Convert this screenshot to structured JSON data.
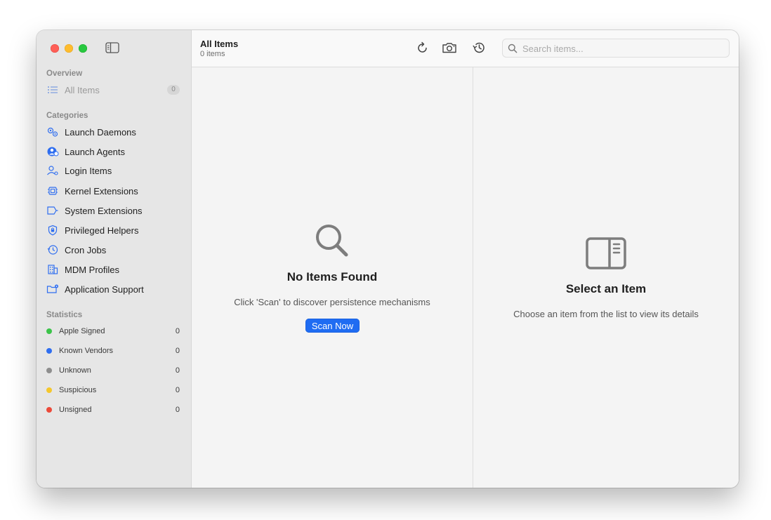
{
  "sidebar": {
    "overview_title": "Overview",
    "all_items": {
      "label": "All Items",
      "count": "0"
    },
    "categories_title": "Categories",
    "categories": [
      {
        "label": "Launch Daemons",
        "icon": "gears-icon"
      },
      {
        "label": "Launch Agents",
        "icon": "person-circle-icon"
      },
      {
        "label": "Login Items",
        "icon": "person-gear-icon"
      },
      {
        "label": "Kernel Extensions",
        "icon": "cpu-icon"
      },
      {
        "label": "System Extensions",
        "icon": "puzzle-icon"
      },
      {
        "label": "Privileged Helpers",
        "icon": "shield-icon"
      },
      {
        "label": "Cron Jobs",
        "icon": "clock-icon"
      },
      {
        "label": "MDM Profiles",
        "icon": "building-icon"
      },
      {
        "label": "Application Support",
        "icon": "folder-gear-icon"
      }
    ],
    "statistics_title": "Statistics",
    "statistics": [
      {
        "label": "Apple Signed",
        "count": "0",
        "color": "#3cc44a"
      },
      {
        "label": "Known Vendors",
        "count": "0",
        "color": "#2f6ef0"
      },
      {
        "label": "Unknown",
        "count": "0",
        "color": "#8e8e8e"
      },
      {
        "label": "Suspicious",
        "count": "0",
        "color": "#f5c72c"
      },
      {
        "label": "Unsigned",
        "count": "0",
        "color": "#ec4a3a"
      }
    ]
  },
  "toolbar": {
    "title": "All Items",
    "subtitle": "0 items",
    "search_placeholder": "Search items..."
  },
  "list_pane": {
    "empty_title": "No Items Found",
    "empty_subtitle": "Click 'Scan' to discover persistence mechanisms",
    "scan_button": "Scan Now"
  },
  "detail_pane": {
    "title": "Select an Item",
    "subtitle": "Choose an item from the list to view its details"
  },
  "colors": {
    "accent": "#1f6cf2",
    "icon_blue": "#2f6ef0"
  }
}
